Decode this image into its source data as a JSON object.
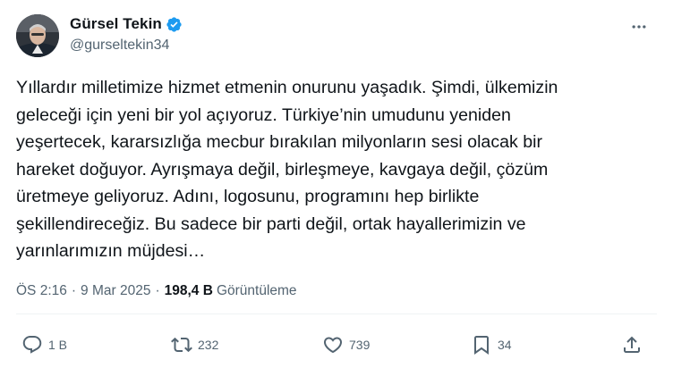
{
  "author": {
    "display_name": "Gürsel Tekin",
    "handle": "@gurseltekin34",
    "verified": true
  },
  "tweet": {
    "text": "Yıllardır milletimize hizmet etmenin onurunu yaşadık. Şimdi, ülkemizin\ngeleceği için yeni bir yol açıyoruz. Türkiye’nin umudunu yeniden\nyeşertecek, kararsızlığa mecbur bırakılan milyonların sesi olacak bir\nhareket doğuyor. Ayrışmaya değil, birleşmeye, kavgaya değil, çözüm\nüretmeye geliyoruz. Adını, logosunu, programını hep birlikte\nşekillendireceğiz. Bu sadece bir parti değil, ortak hayallerimizin ve\nyarınlarımızın müjdesi…"
  },
  "meta": {
    "time": "ÖS 2:16",
    "separator": "·",
    "date": "9 Mar 2025",
    "views_count": "198,4 B",
    "views_label": "Görüntüleme"
  },
  "actions": {
    "reply_count": "1 B",
    "retweet_count": "232",
    "like_count": "739",
    "bookmark_count": "34"
  },
  "colors": {
    "text_primary": "#0f1419",
    "text_secondary": "#536471",
    "verified_badge": "#1d9bf0",
    "divider": "#eff3f4"
  },
  "icons": {
    "more": "more-icon",
    "verified": "verified-badge-icon",
    "reply": "reply-icon",
    "retweet": "retweet-icon",
    "like": "heart-icon",
    "bookmark": "bookmark-icon",
    "share": "share-icon"
  }
}
